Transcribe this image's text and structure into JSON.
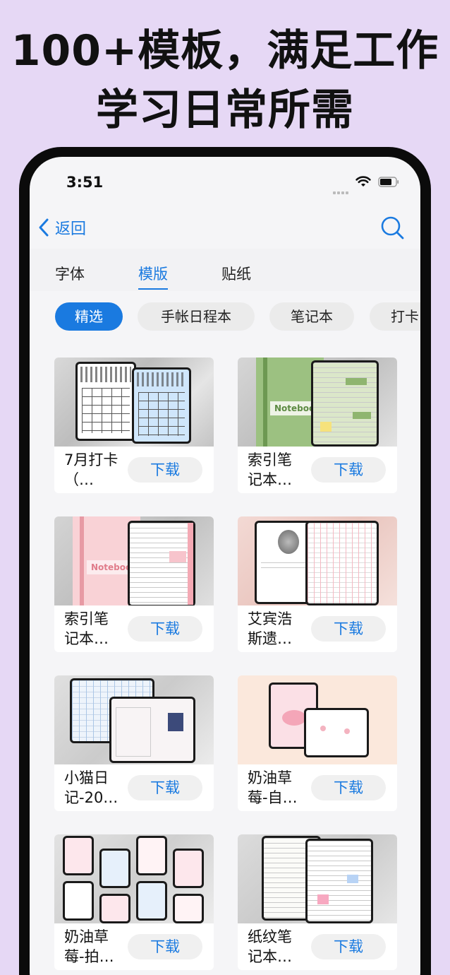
{
  "headline": {
    "line1": "100+模板，满足工作",
    "line2": "学习日常所需"
  },
  "status_bar": {
    "time": "3:51"
  },
  "nav": {
    "back_label": "返回",
    "search_icon": "search-icon"
  },
  "tabs": [
    {
      "label": "字体",
      "active": false
    },
    {
      "label": "模版",
      "active": true
    },
    {
      "label": "贴纸",
      "active": false
    }
  ],
  "chips": [
    {
      "label": "精选",
      "active": true
    },
    {
      "label": "手帐日程本",
      "active": false
    },
    {
      "label": "笔记本",
      "active": false
    },
    {
      "label": "打卡",
      "active": false
    }
  ],
  "templates": [
    {
      "title": "7月打卡（…",
      "button": "下载"
    },
    {
      "title": "索引笔记本…",
      "button": "下载"
    },
    {
      "title": "索引笔记本…",
      "button": "下载"
    },
    {
      "title": "艾宾浩斯遗…",
      "button": "下载"
    },
    {
      "title": "小猫日记-20…",
      "button": "下载"
    },
    {
      "title": "奶油草莓-自…",
      "button": "下载"
    },
    {
      "title": "奶油草莓-拍…",
      "button": "下载"
    },
    {
      "title": "纸纹笔记本…",
      "button": "下载"
    }
  ],
  "colors": {
    "accent": "#1a7ae0",
    "background": "#e6d8f5"
  }
}
